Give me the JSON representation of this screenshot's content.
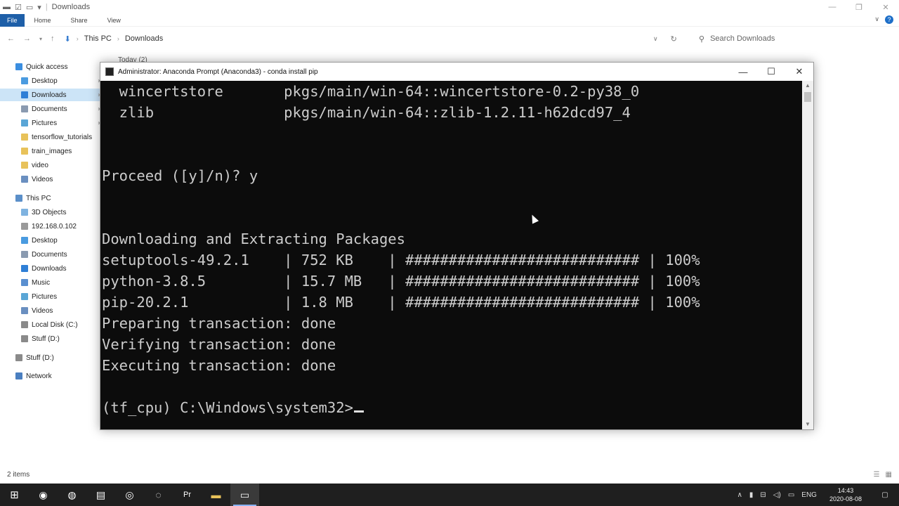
{
  "explorer": {
    "window_title": "Downloads",
    "ribbon_tabs": [
      "File",
      "Home",
      "Share",
      "View"
    ],
    "breadcrumb": [
      "This PC",
      "Downloads"
    ],
    "search_placeholder": "Search Downloads",
    "group_header": "Today (2)",
    "status_items": "2 items",
    "nav": {
      "quick_access": "Quick access",
      "quick_items": [
        "Desktop",
        "Downloads",
        "Documents",
        "Pictures",
        "tensorflow_tutorials",
        "train_images",
        "video",
        "Videos"
      ],
      "this_pc": "This PC",
      "pc_items": [
        "3D Objects",
        "192.168.0.102",
        "Desktop",
        "Documents",
        "Downloads",
        "Music",
        "Pictures",
        "Videos",
        "Local Disk (C:)",
        "Stuff (D:)"
      ],
      "stuff_drive": "Stuff (D:)",
      "network": "Network"
    }
  },
  "console": {
    "title": "Administrator: Anaconda Prompt (Anaconda3) - conda  install pip",
    "lines": [
      "  wincertstore       pkgs/main/win-64::wincertstore-0.2-py38_0",
      "  zlib               pkgs/main/win-64::zlib-1.2.11-h62dcd97_4",
      "",
      "Proceed ([y]/n)? y",
      "",
      "Downloading and Extracting Packages",
      "setuptools-49.2.1    | 752 KB    | ########################### | 100%",
      "python-3.8.5         | 15.7 MB   | ########################### | 100%",
      "pip-20.2.1           | 1.8 MB    | ########################### | 100%",
      "Preparing transaction: done",
      "Verifying transaction: done",
      "Executing transaction: done",
      "",
      "(tf_cpu) C:\\Windows\\system32>"
    ]
  },
  "taskbar": {
    "language": "ENG",
    "time": "14:43",
    "date": "2020-08-08"
  },
  "colors": {
    "console_bg": "#0c0c0c",
    "console_text": "#cccccc",
    "selection": "#cce4f7",
    "file_tab": "#1e5fa8",
    "taskbar": "#1f1f1f"
  }
}
